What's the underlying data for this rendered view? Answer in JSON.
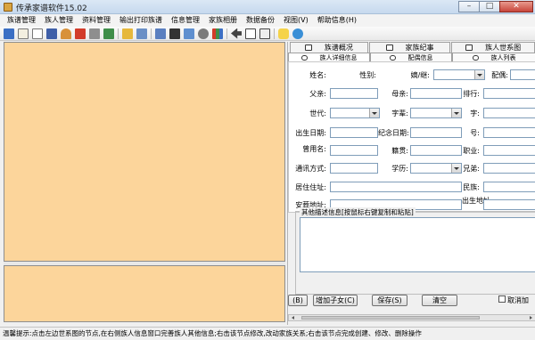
{
  "window": {
    "title": "传承家谱软件15.02",
    "minimize": "–",
    "maximize": "□",
    "close": "✕"
  },
  "menu": [
    "族谱管理",
    "族人管理",
    "资料管理",
    "输出打印族谱",
    "信息管理",
    "家族相册",
    "数据备份",
    "视图(V)",
    "帮助信息(H)"
  ],
  "tabs_top": [
    "族谱概况",
    "家族纪事",
    "族人世系图"
  ],
  "tabs_second": [
    "族人详细信息",
    "配偶信息",
    "族人列表"
  ],
  "form": {
    "name_label": "姓名:",
    "gender_label": "性别:",
    "adopted_label": "嫡/继:",
    "spouse_label": "配偶:",
    "father_label": "父亲:",
    "mother_label": "母亲:",
    "rank_label": "排行:",
    "generation_label": "世代:",
    "zibei_label": "字辈:",
    "courtesy_label": "字:",
    "birth_label": "出生日期:",
    "memorial_label": "纪念日期:",
    "hao_label": "号:",
    "alias_label": "曾用名:",
    "native_label": "籍贯:",
    "job_label": "职业:",
    "contact_label": "通讯方式:",
    "education_label": "学历:",
    "siblings_label": "兄弟:",
    "residence_label": "居住住址:",
    "ethnic_label": "民族:",
    "burial_label": "安葬地址:",
    "birthplace_label": "出生地址:"
  },
  "other_info_title": "其他描述信息[按鼠标右键复制和粘贴]",
  "buttons": {
    "prev": "(B)",
    "add_child": "增加子女(C)",
    "save": "保存(S)",
    "clear": "清空",
    "cancel_add": "取消加"
  },
  "statusbar": "温馨提示:点击左边世系图的节点,在右侧族人信息窗口完善族人其他信息;右击该节点修改,改动家族关系;右击该节点完成创建、修改、删除操作"
}
